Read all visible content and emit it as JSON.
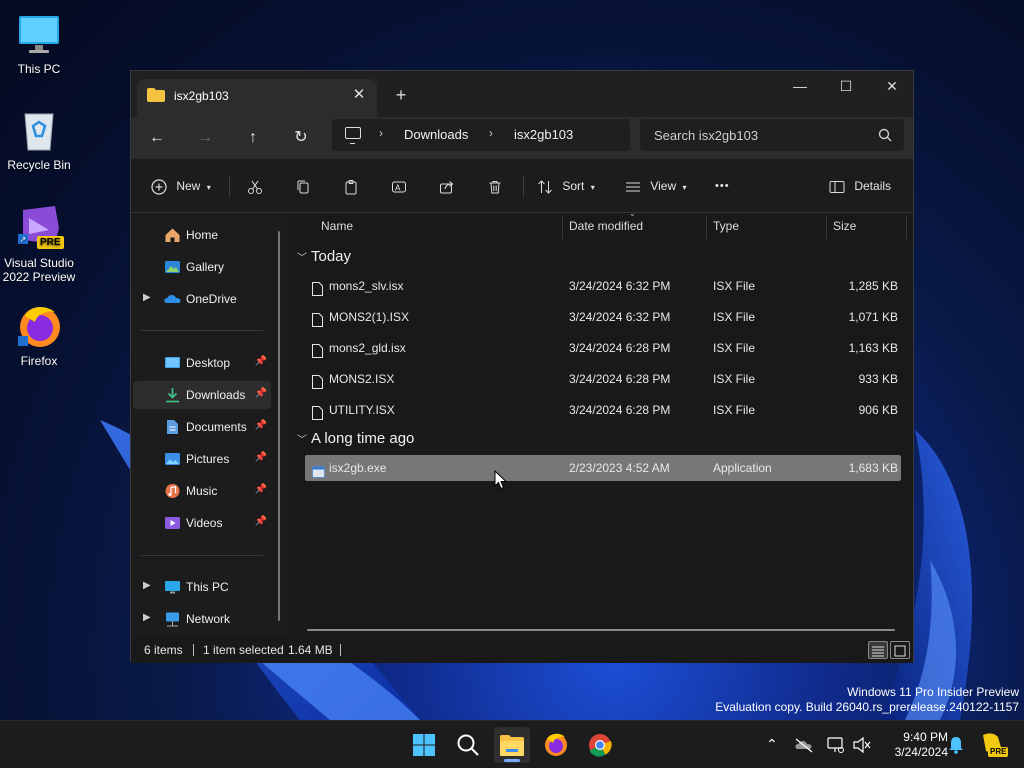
{
  "desktop": {
    "icons": [
      {
        "label": "This PC"
      },
      {
        "label": "Recycle Bin"
      },
      {
        "label": "Visual Studio 2022 Preview",
        "badge": "PRE"
      },
      {
        "label": "Firefox"
      }
    ]
  },
  "window": {
    "tab_title": "isx2gb103",
    "new_tab_glyph": "+",
    "controls": {
      "minimize": "—",
      "maximize": "☐",
      "close": "✕"
    },
    "nav": {
      "back": "←",
      "forward": "→",
      "up": "↑",
      "refresh": "↻"
    },
    "breadcrumb": [
      "Downloads",
      "isx2gb103"
    ],
    "search_placeholder": "Search isx2gb103",
    "toolbar": {
      "new_label": "New",
      "sort_label": "Sort",
      "view_label": "View",
      "more_label": "•••",
      "details_label": "Details"
    },
    "sidebar": {
      "quick": [
        {
          "label": "Home",
          "icon": "home-icon"
        },
        {
          "label": "Gallery",
          "icon": "gallery-icon"
        },
        {
          "label": "OneDrive",
          "icon": "onedrive-icon",
          "expandable": true
        }
      ],
      "pinned": [
        {
          "label": "Desktop",
          "icon": "desktop-icon"
        },
        {
          "label": "Downloads",
          "icon": "downloads-icon",
          "selected": true
        },
        {
          "label": "Documents",
          "icon": "documents-icon"
        },
        {
          "label": "Pictures",
          "icon": "pictures-icon"
        },
        {
          "label": "Music",
          "icon": "music-icon"
        },
        {
          "label": "Videos",
          "icon": "videos-icon"
        }
      ],
      "locations": [
        {
          "label": "This PC",
          "icon": "this-pc-icon"
        },
        {
          "label": "Network",
          "icon": "network-icon"
        }
      ]
    },
    "columns": {
      "name": "Name",
      "date": "Date modified",
      "type": "Type",
      "size": "Size"
    },
    "groups": [
      {
        "label": "Today",
        "files": [
          {
            "name": "mons2_slv.isx",
            "date": "3/24/2024 6:32 PM",
            "type": "ISX File",
            "size": "1,285 KB"
          },
          {
            "name": "MONS2(1).ISX",
            "date": "3/24/2024 6:32 PM",
            "type": "ISX File",
            "size": "1,071 KB"
          },
          {
            "name": "mons2_gld.isx",
            "date": "3/24/2024 6:28 PM",
            "type": "ISX File",
            "size": "1,163 KB"
          },
          {
            "name": "MONS2.ISX",
            "date": "3/24/2024 6:28 PM",
            "type": "ISX File",
            "size": "933 KB"
          },
          {
            "name": "UTILITY.ISX",
            "date": "3/24/2024 6:28 PM",
            "type": "ISX File",
            "size": "906 KB"
          }
        ]
      },
      {
        "label": "A long time ago",
        "files": [
          {
            "name": "isx2gb.exe",
            "date": "2/23/2023 4:52 AM",
            "type": "Application",
            "size": "1,683 KB",
            "selected": true
          }
        ]
      }
    ],
    "status": {
      "items": "6 items",
      "selection": "1 item selected",
      "selection_size": "1.64 MB"
    }
  },
  "watermark": {
    "line1": "Windows 11 Pro Insider Preview",
    "line2": "Evaluation copy. Build 26040.rs_prerelease.240122-1157"
  },
  "taskbar": {
    "time": "9:40 PM",
    "date": "3/24/2024",
    "badge": "PRE"
  },
  "colors": {
    "selected_row": "#777777",
    "accent": "#7aa7ff"
  }
}
